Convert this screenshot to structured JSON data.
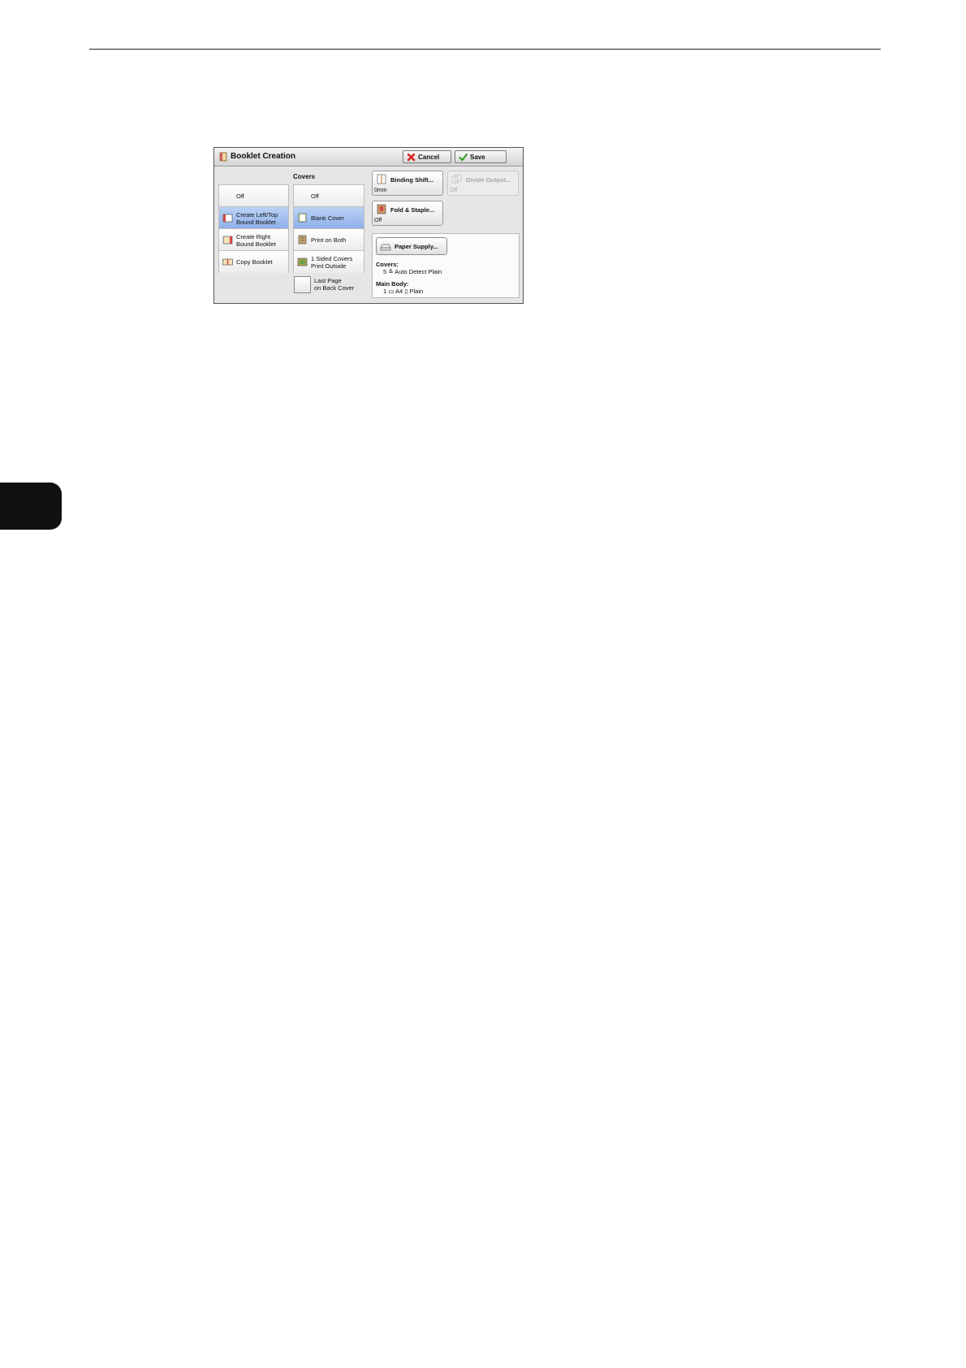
{
  "dialog": {
    "title": "Booklet Creation",
    "cancel_label": "Cancel",
    "save_label": "Save"
  },
  "booklet_options": [
    {
      "label": "Off",
      "selected": false
    },
    {
      "label": "Create Left/Top\nBound Booklet",
      "selected": true
    },
    {
      "label": "Create Right\nBound Booklet",
      "selected": false
    },
    {
      "label": "Copy Booklet",
      "selected": false
    }
  ],
  "covers": {
    "label": "Covers",
    "options": [
      {
        "label": "Off",
        "selected": false
      },
      {
        "label": "Blank Cover",
        "selected": true
      },
      {
        "label": "Print on Both",
        "selected": false
      },
      {
        "label": "1 Sided Covers\nPrint Outside",
        "selected": false
      }
    ],
    "last_page_checkbox_label": "Last Page\non Back Cover"
  },
  "binding_shift": {
    "label": "Binding Shift...",
    "value": "0mm"
  },
  "divide_output": {
    "label": "Divide Output...",
    "value": "Off",
    "disabled": true
  },
  "fold_staple": {
    "label": "Fold & Staple...",
    "value": "Off"
  },
  "paper_supply": {
    "button_label": "Paper Supply...",
    "covers_label": "Covers:",
    "covers_value": "5 ≙ Auto Detect Plain",
    "main_body_label": "Main Body:",
    "main_body_value": "1 ▭ A4 ▯ Plain"
  },
  "colors": {
    "selection": "#9dbcee",
    "side_tab": "#111111"
  }
}
